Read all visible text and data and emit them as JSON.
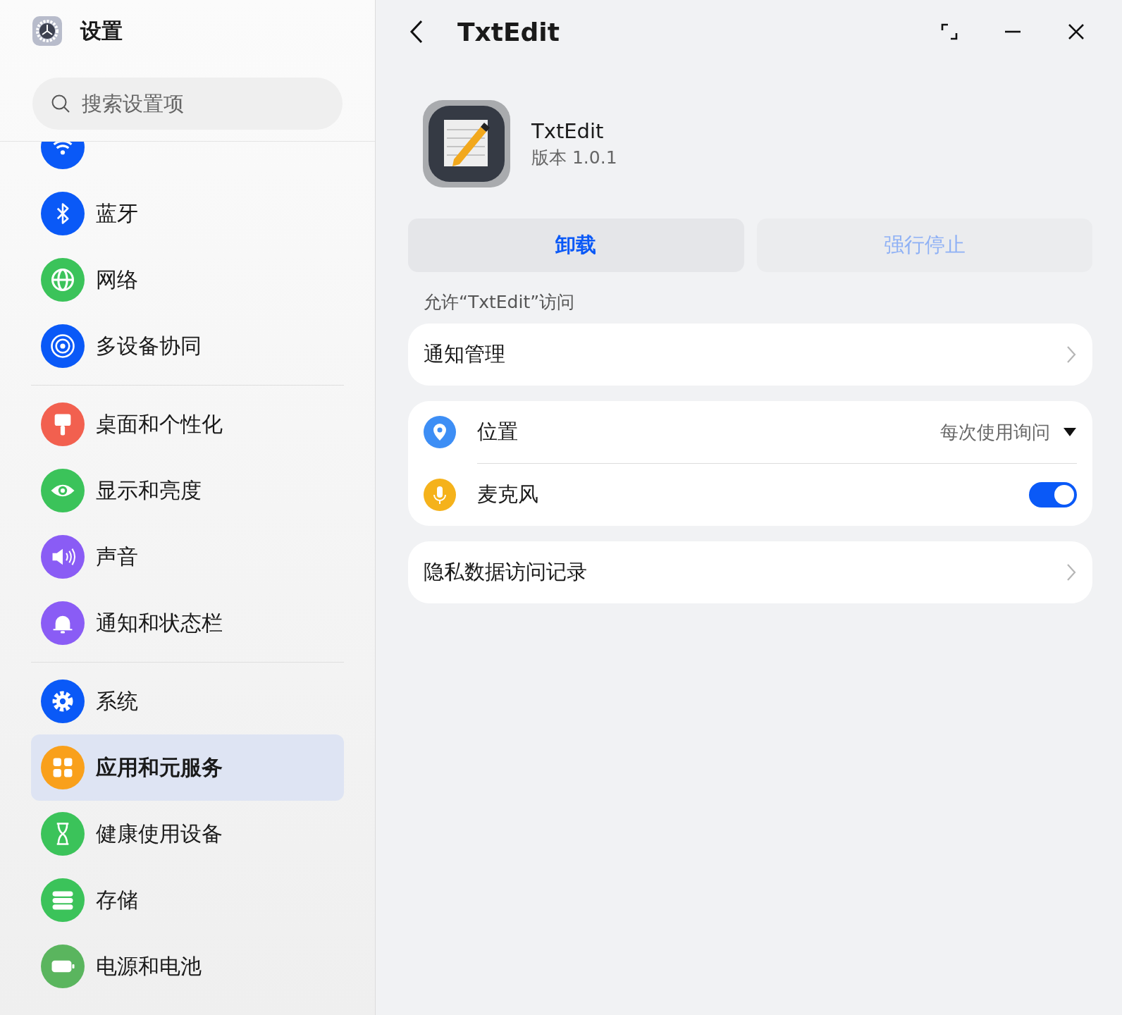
{
  "sidebar": {
    "title": "设置",
    "search": {
      "placeholder": "搜索设置项"
    },
    "groups": [
      {
        "items": [
          {
            "kind": "wifi",
            "color": "#0a59f7",
            "selected": false
          },
          {
            "label": "蓝牙",
            "kind": "bluetooth",
            "color": "#0a59f7",
            "selected": false
          },
          {
            "label": "网络",
            "kind": "globe",
            "color": "#3bc35a",
            "selected": false
          },
          {
            "label": "多设备协同",
            "kind": "devices",
            "color": "#0a59f7",
            "selected": false
          }
        ]
      },
      {
        "items": [
          {
            "label": "桌面和个性化",
            "kind": "brush",
            "color": "#f2604f",
            "selected": false
          },
          {
            "label": "显示和亮度",
            "kind": "eye",
            "color": "#3bc35a",
            "selected": false
          },
          {
            "label": "声音",
            "kind": "speaker",
            "color": "#8a5cf5",
            "selected": false
          },
          {
            "label": "通知和状态栏",
            "kind": "bell",
            "color": "#8a5cf5",
            "selected": false
          }
        ]
      },
      {
        "items": [
          {
            "label": "系统",
            "kind": "gear",
            "color": "#0a59f7",
            "selected": false
          },
          {
            "label": "应用和元服务",
            "kind": "apps",
            "color": "#f9a01b",
            "selected": true
          },
          {
            "label": "健康使用设备",
            "kind": "hourglass",
            "color": "#3bc35a",
            "selected": false
          },
          {
            "label": "存储",
            "kind": "storage",
            "color": "#3bc35a",
            "selected": false
          },
          {
            "label": "电源和电池",
            "kind": "battery",
            "color": "#5ab55e",
            "selected": false
          }
        ]
      }
    ]
  },
  "detail": {
    "title": "TxtEdit",
    "app": {
      "name": "TxtEdit",
      "version": "版本 1.0.1"
    },
    "buttons": [
      {
        "label": "卸载",
        "disabled": false
      },
      {
        "label": "强行停止",
        "disabled": true
      }
    ],
    "section_label": "允许“TxtEdit”访问",
    "cards": [
      {
        "rows": [
          {
            "kind": "link",
            "label": "通知管理"
          }
        ]
      },
      {
        "rows": [
          {
            "kind": "select",
            "color": "#3d8ef5",
            "label": "位置",
            "value": "每次使用询问"
          },
          {
            "kind": "toggle",
            "color": "#f5b21b",
            "label": "麦克风",
            "on": true
          }
        ]
      },
      {
        "rows": [
          {
            "kind": "link",
            "label": "隐私数据访问记录"
          }
        ]
      }
    ]
  }
}
